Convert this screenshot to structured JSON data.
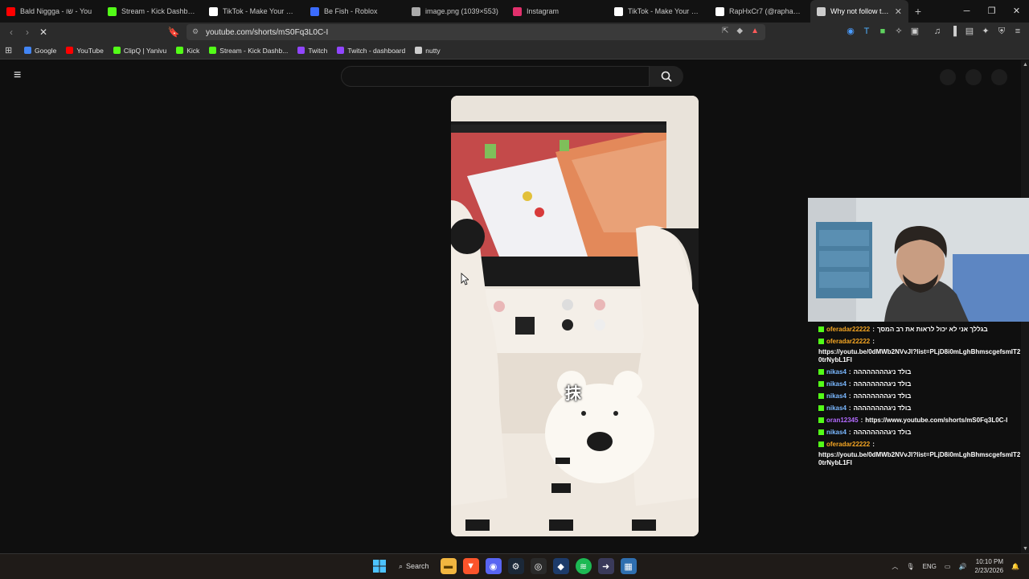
{
  "tabs": [
    {
      "title": "Bald Niggga - שו - You",
      "icon": "youtube-icon",
      "color": "#ff0000"
    },
    {
      "title": "Stream - Kick Dashboard",
      "icon": "kick-icon",
      "color": "#53fc18"
    },
    {
      "title": "TikTok - Make Your Day",
      "icon": "tiktok-icon",
      "color": "#ffffff"
    },
    {
      "title": "Be Fish - Roblox",
      "icon": "roblox-icon",
      "color": "#3b6cff"
    },
    {
      "title": "image.png (1039×553)",
      "icon": "globe-icon",
      "color": "#aaaaaa"
    },
    {
      "title": "Instagram",
      "icon": "instagram-icon",
      "color": "#e1306c"
    },
    {
      "title": "TikTok - Make Your Day",
      "icon": "tiktok-icon",
      "color": "#ffffff"
    },
    {
      "title": "RapHxCr7 (@raphael.oliv...",
      "icon": "tiktok-icon",
      "color": "#ffffff"
    },
    {
      "title": "Why not follow the...",
      "icon": "loading-icon",
      "color": "#cccccc",
      "active": true
    }
  ],
  "address": {
    "url": "youtube.com/shorts/mS0Fq3L0C-I"
  },
  "bookmarks": [
    {
      "label": "Google",
      "color": "#4285f4"
    },
    {
      "label": "YouTube",
      "color": "#ff0000"
    },
    {
      "label": "ClipQ | Yanivu",
      "color": "#53fc18"
    },
    {
      "label": "Kick",
      "color": "#53fc18"
    },
    {
      "label": "Stream - Kick Dashb...",
      "color": "#53fc18"
    },
    {
      "label": "Twitch",
      "color": "#9146ff"
    },
    {
      "label": "Twitch - dashboard",
      "color": "#9146ff"
    },
    {
      "label": "nutty",
      "color": "#cccccc"
    }
  ],
  "video": {
    "overlay_char": "抹"
  },
  "chat": [
    {
      "user": "oferadar22222",
      "user_color": "#f5a623",
      "text": "בגללך אני לא יכול לראות את רב המסך"
    },
    {
      "user": "oferadar22222",
      "user_color": "#f5a623",
      "text": "https://youtu.be/0dMWb2NVvJI?list=PLjD8i0mLghBhmscgefsmIT20trNybL1FI"
    },
    {
      "user": "nikas4",
      "user_color": "#7ab8ff",
      "text": "בולד ניגהההההההה"
    },
    {
      "user": "nikas4",
      "user_color": "#7ab8ff",
      "text": "בולד ניגהההההההה"
    },
    {
      "user": "nikas4",
      "user_color": "#7ab8ff",
      "text": "בולד ניגהההההההה"
    },
    {
      "user": "nikas4",
      "user_color": "#7ab8ff",
      "text": "בולד ניגהההההההה"
    },
    {
      "user": "oran12345",
      "user_color": "#b36bff",
      "text": "https://www.youtube.com/shorts/mS0Fq3L0C-I"
    },
    {
      "user": "nikas4",
      "user_color": "#7ab8ff",
      "text": "בולד ניגהההההההה"
    },
    {
      "user": "oferadar22222",
      "user_color": "#f5a623",
      "text": "https://youtu.be/0dMWb2NVvJI?list=PLjD8i0mLghBhmscgefsmIT20trNybL1FI"
    }
  ],
  "taskbar": {
    "search_label": "Search",
    "lang": "ENG",
    "time": "10:10 PM",
    "date": "2/23/2026"
  }
}
